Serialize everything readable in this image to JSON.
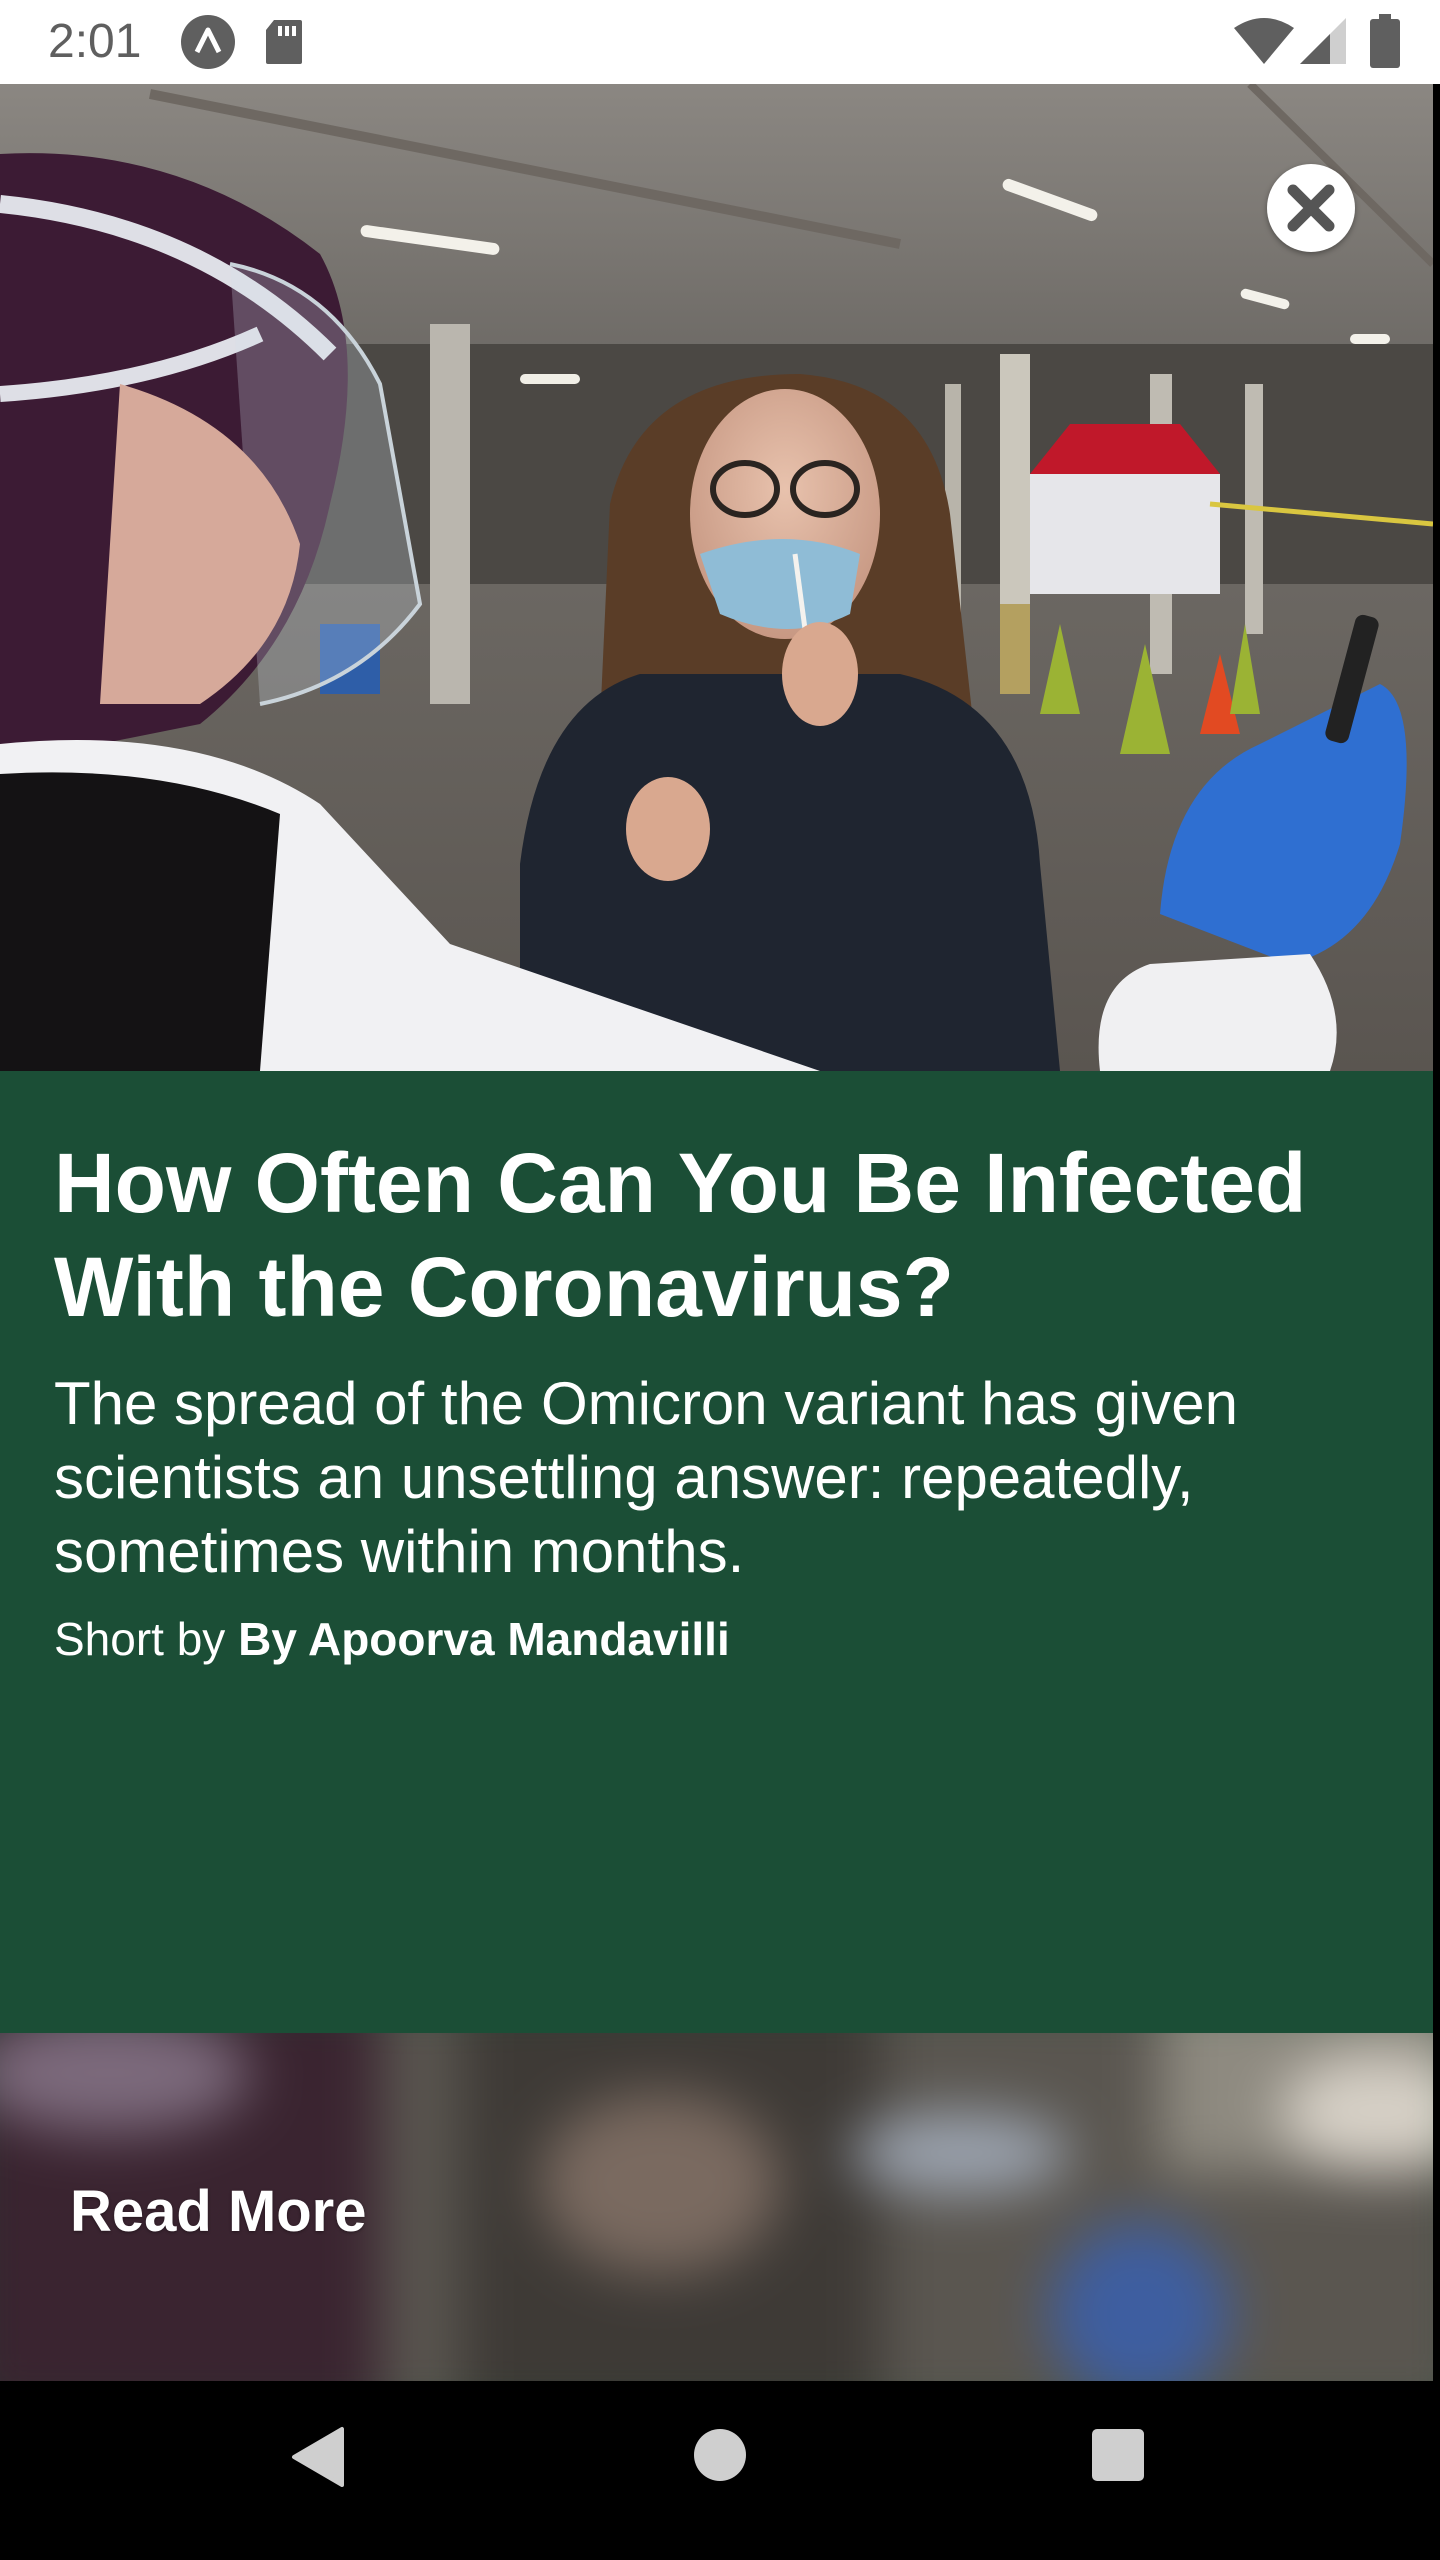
{
  "status_bar": {
    "time": "2:01",
    "icons": [
      "app-launcher-icon",
      "sd-card-icon",
      "wifi-icon",
      "cell-signal-icon",
      "battery-icon"
    ]
  },
  "hero": {
    "image_semantic": "covid-testing-photo",
    "close_icon": "close-icon"
  },
  "article": {
    "headline": "How Often Can You Be Infected With the Coronavirus?",
    "summary": "The spread of the Omicron variant has given scientists an unsettling answer: repeatedly, sometimes within months.",
    "byline_prefix": "Short by ",
    "author": "By Apoorva Mandavilli"
  },
  "read_more": {
    "label": "Read More"
  },
  "navigation": {
    "icons": [
      "back-icon",
      "home-icon",
      "recents-icon"
    ]
  },
  "colors": {
    "card_background": "#1b4e36",
    "text": "#ffffff",
    "status_bar_bg": "#ffffff",
    "nav_bar_bg": "#000000"
  }
}
